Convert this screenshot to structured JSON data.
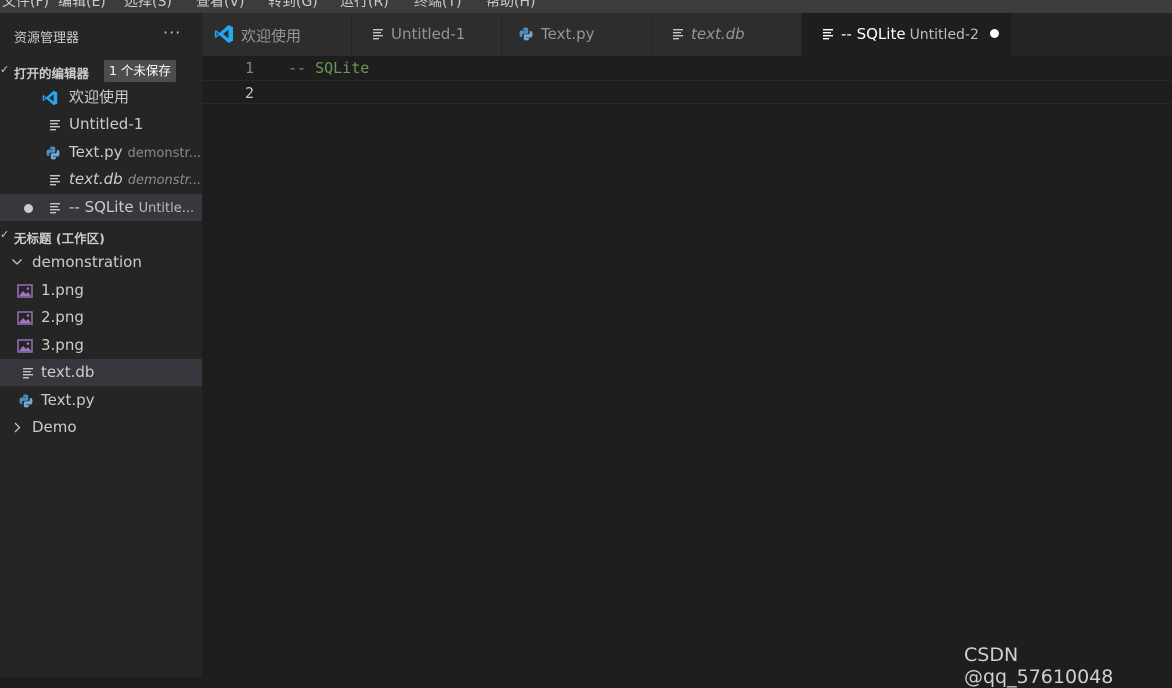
{
  "menubar": {
    "items": [
      "文件(F)",
      "编辑(E)",
      "选择(S)",
      "查看(V)",
      "转到(G)",
      "运行(R)",
      "终端(T)",
      "帮助(H)"
    ]
  },
  "sidebar": {
    "title": "资源管理器",
    "more_label": "···",
    "open_editors": {
      "header": "打开的编辑器",
      "badge": "1 个未保存",
      "items": [
        {
          "name": "欢迎使用",
          "desc": "",
          "icon": "vscode-icon",
          "italic": false,
          "modified": false
        },
        {
          "name": "Untitled-1",
          "desc": "",
          "icon": "file-text-icon",
          "italic": false,
          "modified": false
        },
        {
          "name": "Text.py",
          "desc": "demonstr...",
          "icon": "python-icon",
          "italic": false,
          "modified": false
        },
        {
          "name": "text.db",
          "desc": "demonstr...",
          "icon": "file-text-icon",
          "italic": true,
          "modified": false
        },
        {
          "name": "-- SQLite",
          "desc": "Untitle...",
          "icon": "file-text-icon",
          "italic": false,
          "modified": true
        }
      ]
    },
    "workspace": {
      "header": "无标题 (工作区)",
      "folders": [
        {
          "name": "demonstration",
          "expanded": true,
          "files": [
            {
              "name": "1.png",
              "icon": "image-icon"
            },
            {
              "name": "2.png",
              "icon": "image-icon"
            },
            {
              "name": "3.png",
              "icon": "image-icon"
            },
            {
              "name": "text.db",
              "icon": "file-text-icon",
              "selected": true
            },
            {
              "name": "Text.py",
              "icon": "python-icon"
            }
          ]
        },
        {
          "name": "Demo",
          "expanded": false
        }
      ]
    }
  },
  "tabs": [
    {
      "label": "欢迎使用",
      "desc": "",
      "icon": "vscode-icon",
      "italic": false,
      "active": false
    },
    {
      "label": "Untitled-1",
      "desc": "",
      "icon": "file-text-icon",
      "italic": false,
      "active": false
    },
    {
      "label": "Text.py",
      "desc": "",
      "icon": "python-icon",
      "italic": false,
      "active": false
    },
    {
      "label": "text.db",
      "desc": "",
      "icon": "file-text-icon",
      "italic": true,
      "active": false
    },
    {
      "label": "-- SQLite",
      "desc": "Untitled-2",
      "icon": "file-text-icon",
      "italic": false,
      "active": true,
      "modified": true
    }
  ],
  "editor": {
    "lines": [
      {
        "number": "1",
        "text": "-- SQLite"
      },
      {
        "number": "2",
        "text": ""
      }
    ],
    "current_line": 2
  },
  "watermark": "CSDN @qq_57610048",
  "colors": {
    "sidebar_bg": "#252526",
    "editor_bg": "#1e1e1e",
    "comment": "#6a9955",
    "vscode_blue": "#23a9f2",
    "python_blue": "#3572a5",
    "image_purple": "#a074c4"
  }
}
